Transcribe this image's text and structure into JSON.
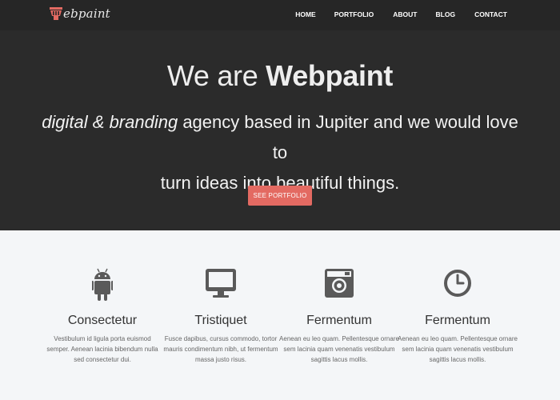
{
  "brand": {
    "logo_text": "ebpaint",
    "accent": "#e36a62"
  },
  "nav": {
    "items": [
      {
        "label": "HOME"
      },
      {
        "label": "PORTFOLIO"
      },
      {
        "label": "ABOUT"
      },
      {
        "label": "BLOG"
      },
      {
        "label": "CONTACT"
      }
    ]
  },
  "hero": {
    "title_prefix": "We are ",
    "title_brand": "Webpaint",
    "subtitle_italic": "digital & branding",
    "subtitle_rest_1": " agency based in Jupiter and we would love to",
    "subtitle_rest_2": "turn ideas into beautiful things.",
    "cta_label": "SEE PORTFOLIO"
  },
  "features": [
    {
      "icon": "android-icon",
      "title": "Consectetur",
      "text": "Vestibulum id ligula porta euismod semper. Aenean lacinia bibendum nulla sed consectetur dui."
    },
    {
      "icon": "monitor-icon",
      "title": "Tristiquet",
      "text": "Fusce dapibus, cursus commodo, tortor mauris condimentum nibh, ut fermentum massa justo risus."
    },
    {
      "icon": "camera-icon",
      "title": "Fermentum",
      "text": "Aenean eu leo quam. Pellentesque ornare sem lacinia quam venenatis vestibulum sagittis lacus mollis."
    },
    {
      "icon": "clock-icon",
      "title": "Fermentum",
      "text": "Aenean eu leo quam. Pellentesque ornare sem lacinia quam venenatis vestibulum sagittis lacus mollis."
    }
  ]
}
